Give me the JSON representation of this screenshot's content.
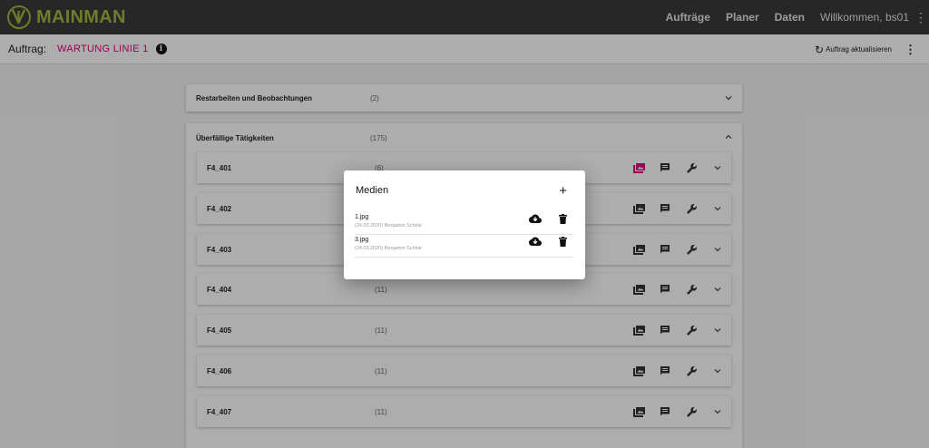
{
  "app": {
    "brand": "MAINMAN",
    "accent": "#a5b540",
    "highlight": "#e6007e"
  },
  "nav": {
    "items": [
      "Aufträge",
      "Planer",
      "Daten"
    ],
    "user": "Willkommen, bs01",
    "menu_glyph": "⋮"
  },
  "subbar": {
    "label": "Auftrag:",
    "order_name": "WARTUNG LINIE 1",
    "info_glyph": "i",
    "refresh_glyph": "↻",
    "refresh_label": "Auftrag aktualisieren",
    "menu_glyph": "⋮"
  },
  "sections": [
    {
      "title": "Restarbeiten und Beobachtungen",
      "count": "(2)",
      "expanded": false
    },
    {
      "title": "Überfällige Tätigkeiten",
      "count": "(175)",
      "expanded": true
    }
  ],
  "rows": [
    {
      "name": "F4_401",
      "count": "(6)",
      "media_active": true
    },
    {
      "name": "F4_402",
      "count": "",
      "media_active": false
    },
    {
      "name": "F4_403",
      "count": "",
      "media_active": false
    },
    {
      "name": "F4_404",
      "count": "(11)",
      "media_active": false
    },
    {
      "name": "F4_405",
      "count": "(11)",
      "media_active": false
    },
    {
      "name": "F4_406",
      "count": "(11)",
      "media_active": false
    },
    {
      "name": "F4_407",
      "count": "(11)",
      "media_active": false
    }
  ],
  "dialog": {
    "title": "Medien",
    "add_glyph": "+",
    "items": [
      {
        "file": "1.jpg",
        "meta": "(24.03.2020) Benjamin Schirle"
      },
      {
        "file": "3.jpg",
        "meta": "(24.03.2020) Benjamin Schirle"
      }
    ]
  },
  "icons": [
    "logo-icon",
    "info-icon",
    "refresh-icon",
    "kebab-icon",
    "chevron-down-icon",
    "chevron-up-icon",
    "photo-library-icon",
    "comment-icon",
    "wrench-icon",
    "cloud-download-icon",
    "delete-icon",
    "add-icon"
  ]
}
